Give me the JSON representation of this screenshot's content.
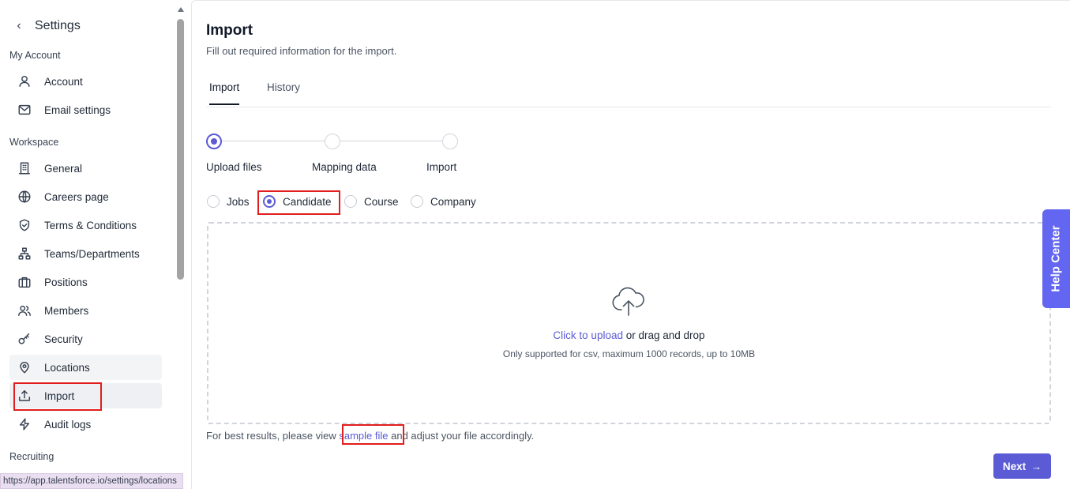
{
  "sidebar": {
    "title": "Settings",
    "sections": {
      "my_account": "My Account",
      "workspace": "Workspace",
      "recruiting": "Recruiting"
    },
    "items": [
      {
        "label": "Account",
        "icon": "user-icon"
      },
      {
        "label": "Email settings",
        "icon": "mail-icon"
      },
      {
        "label": "General",
        "icon": "building-icon"
      },
      {
        "label": "Careers page",
        "icon": "globe-icon"
      },
      {
        "label": "Terms & Conditions",
        "icon": "shield-check-icon"
      },
      {
        "label": "Teams/Departments",
        "icon": "org-chart-icon"
      },
      {
        "label": "Positions",
        "icon": "briefcase-icon"
      },
      {
        "label": "Members",
        "icon": "users-icon"
      },
      {
        "label": "Security",
        "icon": "key-icon"
      },
      {
        "label": "Locations",
        "icon": "map-pin-icon"
      },
      {
        "label": "Import",
        "icon": "upload-icon"
      },
      {
        "label": "Audit logs",
        "icon": "bolt-icon"
      }
    ]
  },
  "main": {
    "title": "Import",
    "subtitle": "Fill out required information for the import.",
    "tabs": [
      {
        "label": "Import",
        "active": true
      },
      {
        "label": "History",
        "active": false
      }
    ],
    "steps": [
      {
        "label": "Upload files",
        "active": true
      },
      {
        "label": "Mapping data",
        "active": false
      },
      {
        "label": "Import",
        "active": false
      }
    ],
    "import_types": [
      {
        "label": "Jobs",
        "selected": false
      },
      {
        "label": "Candidate",
        "selected": true
      },
      {
        "label": "Course",
        "selected": false
      },
      {
        "label": "Company",
        "selected": false
      }
    ],
    "dropzone": {
      "icon": "cloud-upload-icon",
      "upload_link": "Click to upload",
      "upload_rest": " or drag and drop",
      "note": "Only supported for csv, maximum 1000 records, up to 10MB"
    },
    "hint": {
      "before": "For best results, please view ",
      "link": "sample file",
      "after": " and adjust your file accordingly."
    },
    "next_label": "Next"
  },
  "help_center": "Help Center",
  "status_url": "https://app.talentsforce.io/settings/locations",
  "colors": {
    "accent": "#5b5bd6",
    "help_tab": "#6366f1",
    "highlight": "#e11d1d"
  }
}
